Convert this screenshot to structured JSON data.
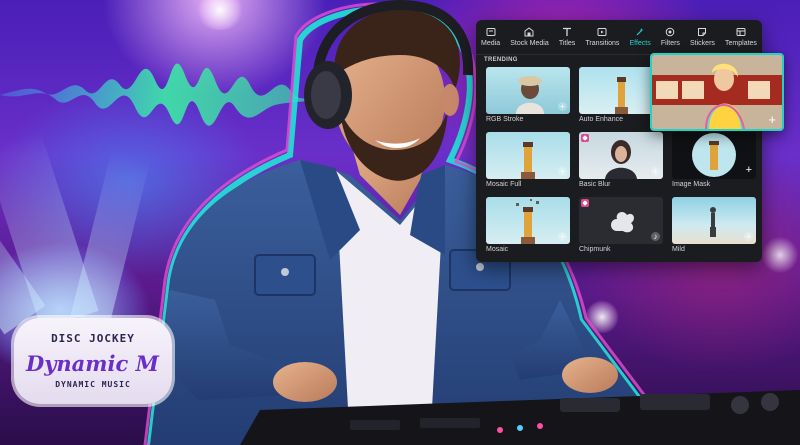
{
  "tabs": [
    {
      "label": "Media",
      "icon": "media-icon"
    },
    {
      "label": "Stock Media",
      "icon": "stock-media-icon"
    },
    {
      "label": "Titles",
      "icon": "titles-icon"
    },
    {
      "label": "Transitions",
      "icon": "transitions-icon"
    },
    {
      "label": "Effects",
      "icon": "effects-icon",
      "active": true
    },
    {
      "label": "Filters",
      "icon": "filters-icon"
    },
    {
      "label": "Stickers",
      "icon": "stickers-icon"
    },
    {
      "label": "Templates",
      "icon": "templates-icon"
    }
  ],
  "section_title": "TRENDING",
  "effects": [
    {
      "name": "RGB Stroke"
    },
    {
      "name": "Auto Enhance"
    },
    {
      "name": "Mosaic Full"
    },
    {
      "name": "Basic Blur"
    },
    {
      "name": "Image Mask"
    },
    {
      "name": "Mosaic"
    },
    {
      "name": "Chipmunk"
    },
    {
      "name": "Mild"
    }
  ],
  "logo": {
    "top": "DISC JOCKEY",
    "main": "Dynamic M",
    "bottom": "DYNAMIC MUSIC"
  },
  "colors": {
    "accent": "#22d3c5",
    "panel_bg": "#1b1c1f",
    "premium_badge": "#e0488f",
    "wave": "#3fe0a8"
  }
}
